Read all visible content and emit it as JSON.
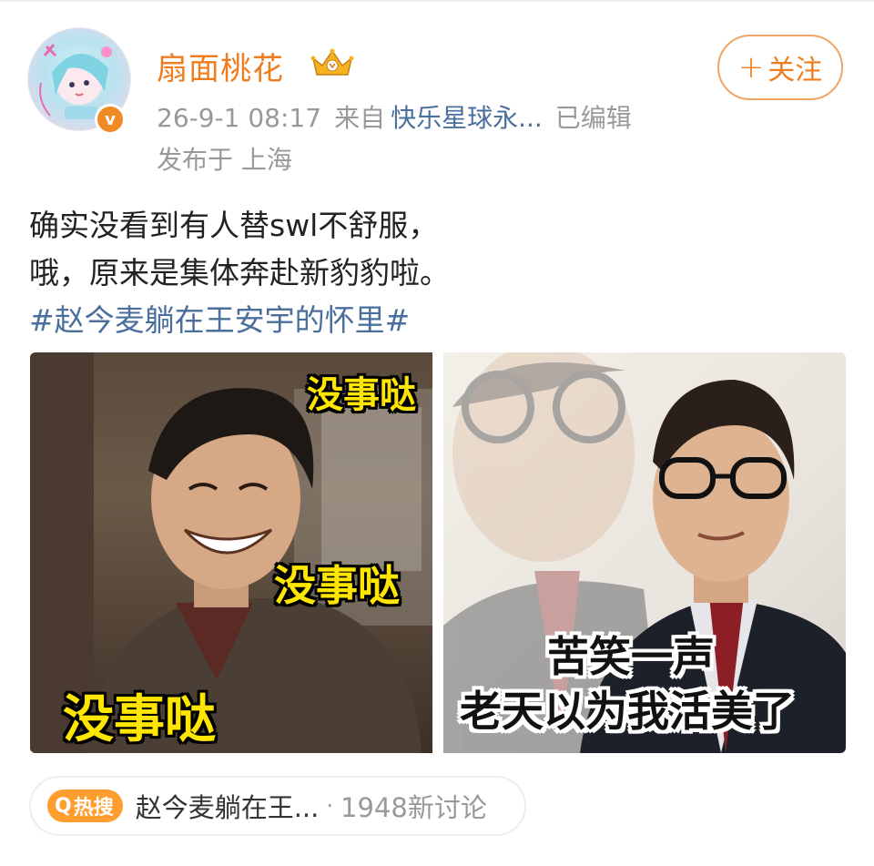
{
  "author": {
    "name": "扇面桃花",
    "verified_mark": "v",
    "icons": [
      "crown-badge-icon",
      "verified-icon"
    ]
  },
  "meta": {
    "timestamp": "26-9-1 08:17",
    "from_prefix": "来自",
    "source": "快乐星球永...",
    "edited": "已编辑",
    "location": "发布于 上海"
  },
  "follow": {
    "plus": "+",
    "label": "关注"
  },
  "post": {
    "line1": "确实没看到有人替swl不舒服，",
    "line2": "哦，原来是集体奔赴新豹豹啦。",
    "hashtag": "#赵今麦躺在王安宇的怀里#"
  },
  "images": {
    "left": {
      "caption_top": "没事哒",
      "caption_middle": "没事哒",
      "caption_bottom": "没事哒"
    },
    "right": {
      "caption_line1": "苦笑一声",
      "caption_line2": "老天以为我活美了"
    }
  },
  "hot_search": {
    "badge": "热搜",
    "title": "赵今麦躺在王...",
    "separator": "·",
    "discussion": "1948新讨论"
  },
  "colors": {
    "accent_orange": "#ee7d1f",
    "link_blue": "#4b6f9c",
    "meta_gray": "#999999",
    "meme_yellow": "#ffe600"
  }
}
